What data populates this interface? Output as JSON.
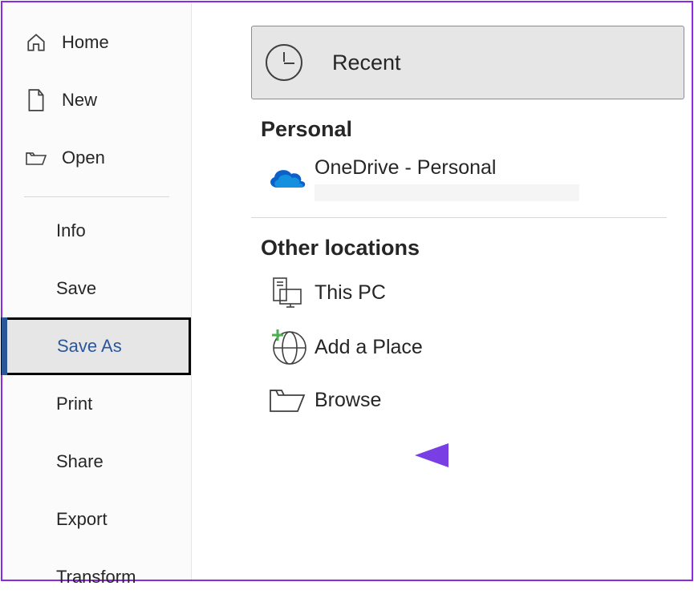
{
  "sidebar": {
    "home": "Home",
    "new": "New",
    "open": "Open",
    "info": "Info",
    "save": "Save",
    "saveAs": "Save As",
    "print": "Print",
    "share": "Share",
    "export": "Export",
    "transform": "Transform"
  },
  "main": {
    "recent": "Recent",
    "personal": "Personal",
    "onedrive": "OneDrive - Personal",
    "otherLocations": "Other locations",
    "thisPC": "This PC",
    "addPlace": "Add a Place",
    "browse": "Browse"
  }
}
